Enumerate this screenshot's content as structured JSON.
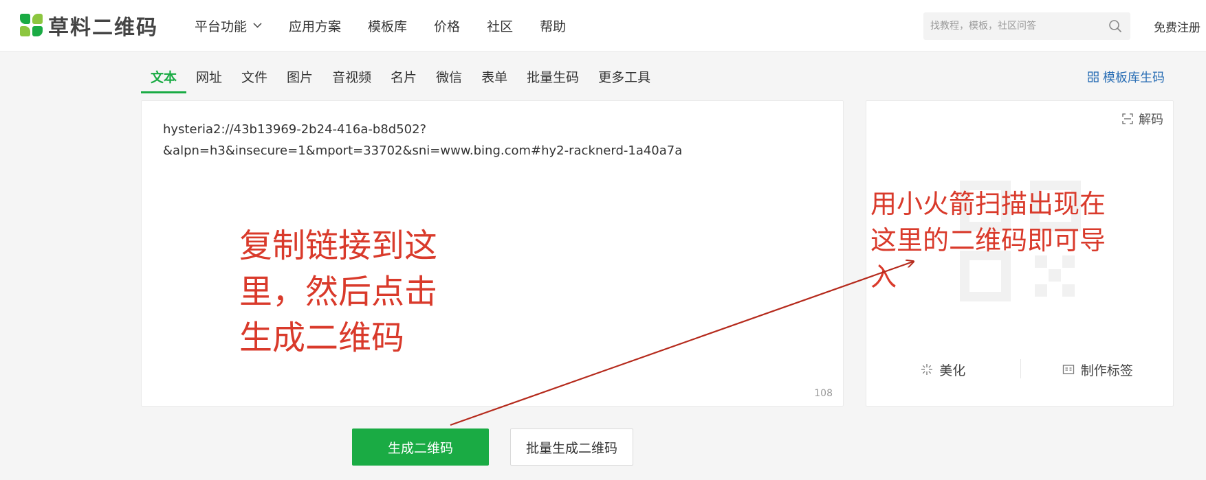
{
  "header": {
    "logo_text": "草料二维码",
    "nav": [
      {
        "label": "平台功能",
        "has_dropdown": true
      },
      {
        "label": "应用方案"
      },
      {
        "label": "模板库"
      },
      {
        "label": "价格"
      },
      {
        "label": "社区"
      },
      {
        "label": "帮助"
      }
    ],
    "search": {
      "placeholder": "找教程，模板，社区问答",
      "value": ""
    },
    "register_label": "免费注册"
  },
  "tabs": {
    "items": [
      "文本",
      "网址",
      "文件",
      "图片",
      "音视频",
      "名片",
      "微信",
      "表单",
      "批量生码",
      "更多工具"
    ],
    "active": "文本",
    "template_link": "模板库生码"
  },
  "editor": {
    "text": "hysteria2://43b13969-2b24-416a-b8d502?\n&alpn=h3&insecure=1&mport=33702&sni=www.bing.com#hy2-racknerd-1a40a7a",
    "char_count": "108"
  },
  "preview": {
    "decode_label": "解码",
    "actions": [
      "美化",
      "制作标签"
    ]
  },
  "buttons": {
    "generate": "生成二维码",
    "batch_generate": "批量生成二维码"
  },
  "annotations": {
    "left": "复制链接到这里，然后点击生成二维码",
    "right": "用小火箭扫描出现在这里的二维码即可导入"
  },
  "colors": {
    "brand_green": "#1aab44",
    "link_blue": "#2b6fb5",
    "annotation_red": "#d93a2b"
  }
}
